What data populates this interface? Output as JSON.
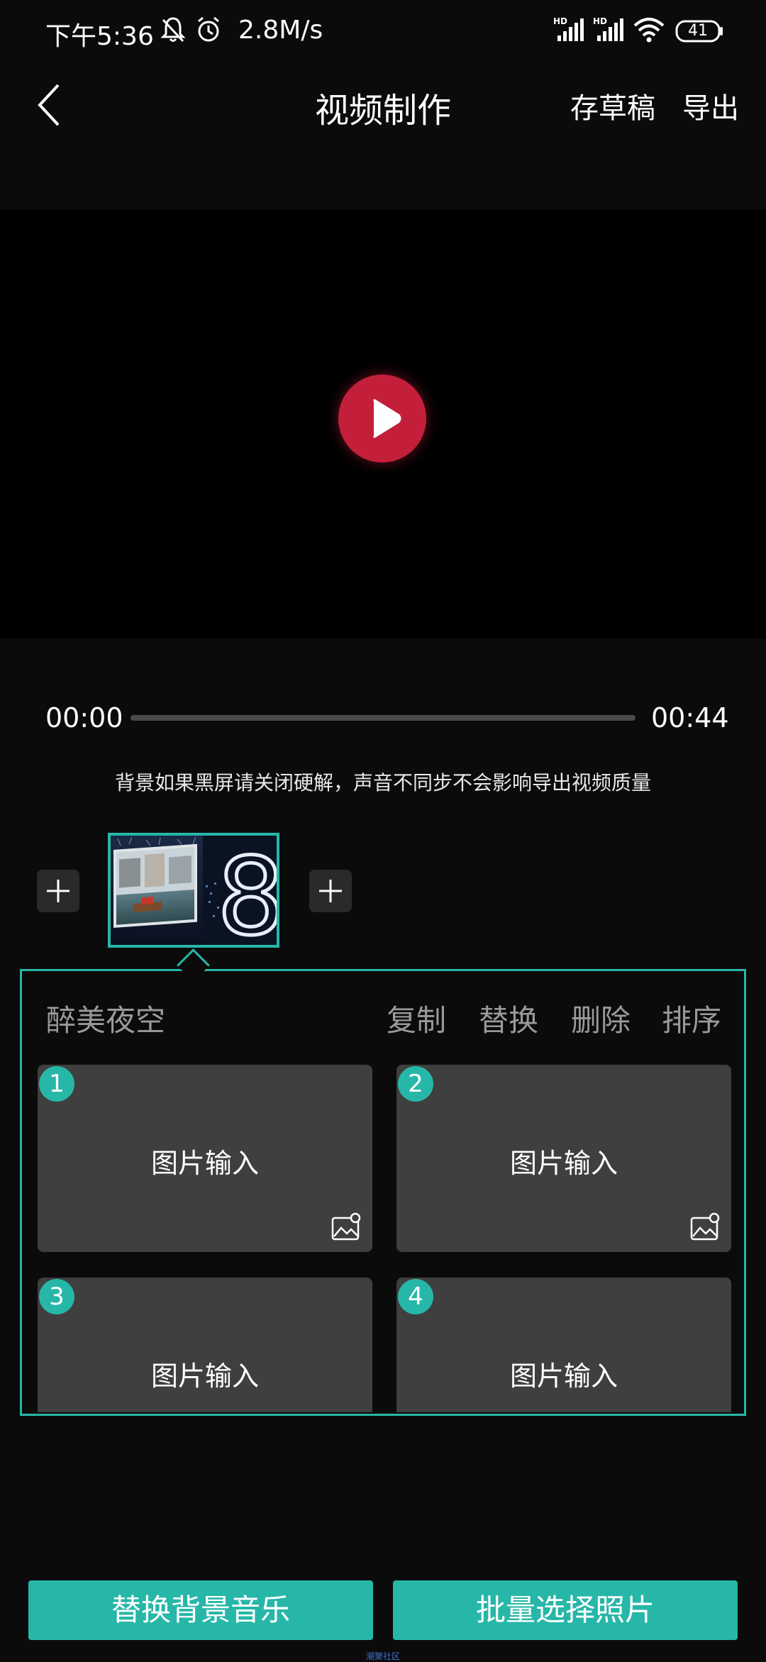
{
  "status_bar": {
    "time": "下午5:36",
    "net_speed": "2.8M/s",
    "battery": "41",
    "icons": [
      "mute-bell-icon",
      "alarm-icon",
      "hd-signal-icon",
      "hd-signal-icon",
      "wifi-icon",
      "battery-icon"
    ]
  },
  "header": {
    "title": "视频制作",
    "save_draft": "存草稿",
    "export": "导出"
  },
  "player": {
    "current_time": "00:00",
    "total_time": "00:44",
    "progress": 0,
    "notice": "背景如果黑屏请关闭硬解，声音不同步不会影响导出视频质量"
  },
  "clips": {
    "thumb_digit": "8"
  },
  "panel": {
    "template_name": "醉美夜空",
    "actions": [
      "复制",
      "替换",
      "删除",
      "排序"
    ],
    "slots": [
      {
        "index": "1",
        "label": "图片输入"
      },
      {
        "index": "2",
        "label": "图片输入"
      },
      {
        "index": "3",
        "label": "图片输入"
      },
      {
        "index": "4",
        "label": "图片输入"
      }
    ]
  },
  "bottom": {
    "replace_music": "替换背景音乐",
    "batch_select": "批量选择照片",
    "watermark": "潮聚社区"
  },
  "colors": {
    "accent": "#27b7a8",
    "play": "#c41f3a",
    "background": "#0b0b0b"
  }
}
